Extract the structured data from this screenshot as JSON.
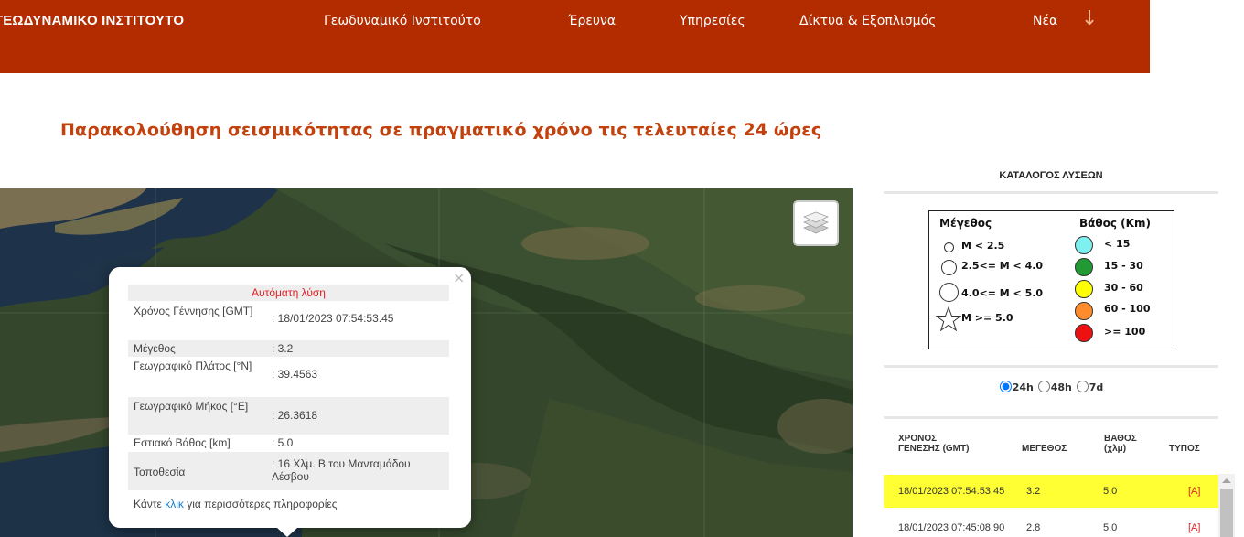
{
  "nav": {
    "brand": "ΓΕΩΔΥΝΑΜΙΚΟ ΙΝΣΤΙΤΟΥΤΟ",
    "items": [
      "Γεωδυναμικό Ινστιτούτο",
      "Έρευνα",
      "Υπηρεσίες",
      "Δίκτυα & Εξοπλισμός",
      "Νέα"
    ],
    "arrow": "↓"
  },
  "page_title": "Παρακολούθηση σεισμικότητας σε πραγματικό χρόνο τις τελευταίες 24 ώρες",
  "popup": {
    "title": "Αυτόματη λύση",
    "rows": [
      {
        "label": "Χρόνος Γέννησης [GMT]",
        "value": ": 18/01/2023 07:54:53.45"
      },
      {
        "label": "Μέγεθος",
        "value": ": 3.2"
      },
      {
        "label": "Γεωγραφικό Πλάτος [°N]",
        "value": ": 39.4563"
      },
      {
        "label": "Γεωγραφικό Μήκος [°E]",
        "value": ": 26.3618"
      },
      {
        "label": "Εστιακό Βάθος [km]",
        "value": ": 5.0"
      },
      {
        "label": "Τοποθεσία",
        "value": ": 16 Χλμ. Β του Μανταμάδου Λέσβου"
      }
    ],
    "footer_before": "Κάντε ",
    "footer_link": "κλικ",
    "footer_after": " για περισσότερες πληροφορίες",
    "close": "×"
  },
  "panel": {
    "title": "ΚΑΤΑΛΟΓΟΣ ΛΥΣΕΩΝ",
    "legend": {
      "magnitude_header": "Μέγεθος",
      "depth_header": "Βάθος (Km)",
      "magnitudes": [
        "M < 2.5",
        "2.5<= M < 4.0",
        "4.0<= M < 5.0",
        "M >= 5.0"
      ],
      "depths": [
        {
          "label": "< 15",
          "color": "#7ff0f0"
        },
        {
          "label": "15 - 30",
          "color": "#229933"
        },
        {
          "label": "30 - 60",
          "color": "#ffff00"
        },
        {
          "label": "60 - 100",
          "color": "#ff8c2a"
        },
        {
          "label": ">= 100",
          "color": "#ee1111"
        }
      ]
    },
    "ranges": [
      {
        "label": "24h",
        "checked": true
      },
      {
        "label": "48h",
        "checked": false
      },
      {
        "label": "7d",
        "checked": false
      }
    ],
    "table": {
      "headers": {
        "time_line1": "ΧΡΟΝΟΣ",
        "time_line2": "ΓΕΝΕΣΗΣ (GMT)",
        "magnitude": "ΜΕΓΕΘΟΣ",
        "depth_line1": "ΒΑΘΟΣ",
        "depth_line2": "(χλμ)",
        "type": "ΤΥΠΟΣ"
      },
      "rows": [
        {
          "time": "18/01/2023 07:54:53.45",
          "magnitude": "3.2",
          "depth": "5.0",
          "type": "[A]",
          "highlight": true
        },
        {
          "time": "18/01/2023 07:45:08.90",
          "magnitude": "2.8",
          "depth": "5.0",
          "type": "[A]",
          "highlight": false
        }
      ]
    }
  }
}
